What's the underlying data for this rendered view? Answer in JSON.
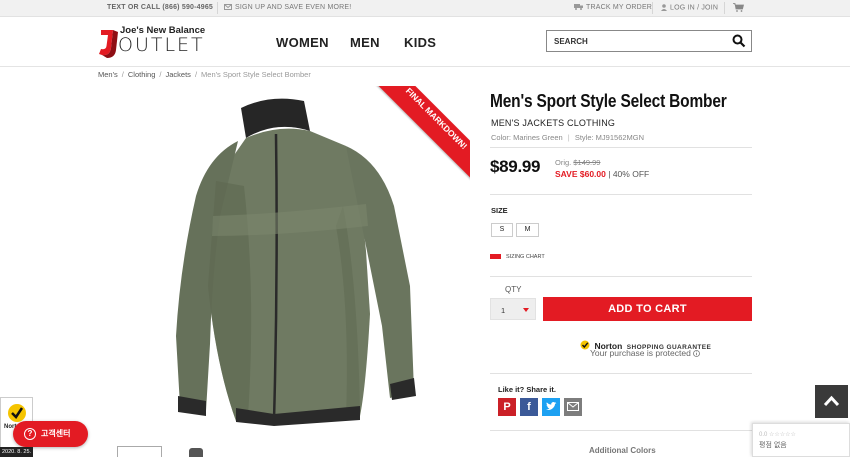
{
  "topbar": {
    "phone": "TEXT OR CALL (866) 590-4965",
    "signup": "SIGN UP AND SAVE EVEN MORE!",
    "track": "TRACK MY ORDER",
    "login": "LOG IN / JOIN"
  },
  "header": {
    "logo_brand": "Joe's New Balance",
    "logo_outlet": "OUTLET",
    "nav": [
      "WOMEN",
      "MEN",
      "KIDS"
    ],
    "search_placeholder": "SEARCH"
  },
  "breadcrumb": [
    "Men's",
    "Clothing",
    "Jackets",
    "Men's Sport Style Select Bomber"
  ],
  "image": {
    "ribbon": "FINAL MARKDOWN!"
  },
  "product": {
    "title": "Men's Sport Style Select Bomber",
    "category": "MEN'S JACKETS CLOTHING",
    "color_label": "Color: Marines Green",
    "style_label": "Style: MJ91562MGN",
    "price": "$89.99",
    "orig_label": "Orig.",
    "orig_price": "$149.99",
    "save": "SAVE $60.00",
    "percent_off": "40% OFF",
    "size_label": "SIZE",
    "sizes": [
      "S",
      "M"
    ],
    "sizing_chart": "SIZING CHART",
    "qty_label": "QTY",
    "qty_value": "1",
    "add_to_cart": "ADD TO CART",
    "norton_name": "Norton",
    "norton_guarantee": "SHOPPING GUARANTEE",
    "norton_sub": "Your purchase is protected",
    "share_label": "Like it? Share it.",
    "additional_colors": "Additional Colors"
  },
  "colors": {
    "brand_red": "#e31b23",
    "pinterest": "#cb2027",
    "facebook": "#3b5998",
    "twitter": "#1da1f2",
    "email": "#7d7d7d",
    "jacket_green": "#6f7a62"
  },
  "floaters": {
    "customer_center": "고객센터",
    "review_stars": "0.0 ☆☆☆☆☆",
    "review_text": "평점 없음",
    "date": "2020. 8. 25."
  }
}
